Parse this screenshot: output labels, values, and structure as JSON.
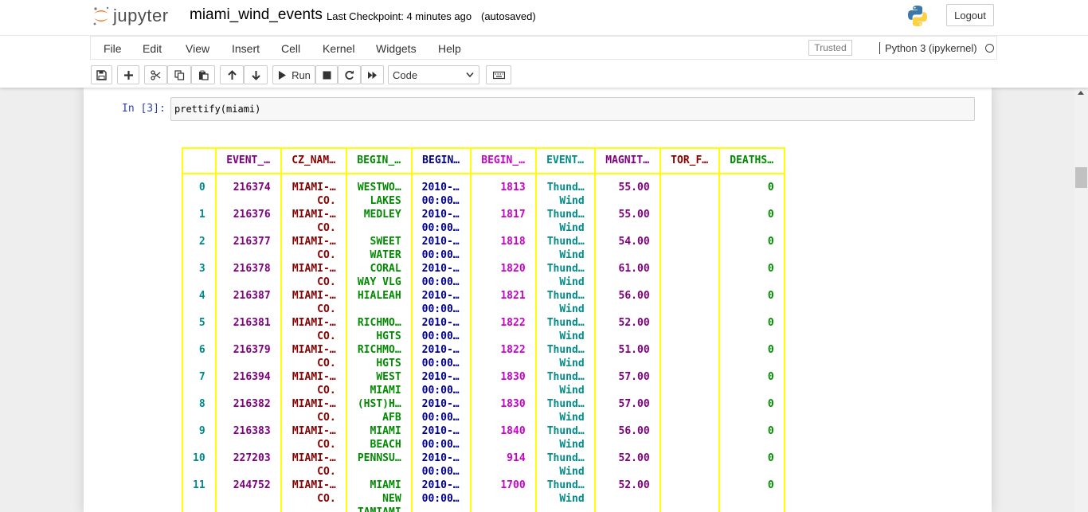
{
  "header": {
    "logo_text": "jupyter",
    "notebook_name": "miami_wind_events",
    "checkpoint": "Last Checkpoint: 4 minutes ago",
    "autosave": "(autosaved)",
    "logout_label": "Logout"
  },
  "menu": {
    "items": [
      "File",
      "Edit",
      "View",
      "Insert",
      "Cell",
      "Kernel",
      "Widgets",
      "Help"
    ],
    "trusted": "Trusted",
    "kernel": "Python 3 (ipykernel)"
  },
  "toolbar": {
    "run_label": "Run",
    "cell_type": "Code"
  },
  "cell": {
    "prompt": "In [3]:",
    "code": "prettify(miami)"
  },
  "table": {
    "headers": [
      "",
      "EVENT_…",
      "CZ_NAM…",
      "BEGIN_…",
      "BEGIN…",
      "BEGIN_…",
      "EVENT…",
      "MAGNIT…",
      "TOR_F…",
      "DEATHS…"
    ],
    "rows": [
      [
        [
          "0"
        ],
        [
          "216374"
        ],
        [
          "MIAMI-…",
          "CO."
        ],
        [
          "WESTWO…",
          "LAKES"
        ],
        [
          "2010-…",
          "00:00…"
        ],
        [
          "1813"
        ],
        [
          "Thund…",
          "Wind"
        ],
        [
          "55.00"
        ],
        [
          ""
        ],
        [
          "0"
        ]
      ],
      [
        [
          "1"
        ],
        [
          "216376"
        ],
        [
          "MIAMI-…",
          "CO."
        ],
        [
          "MEDLEY"
        ],
        [
          "2010-…",
          "00:00…"
        ],
        [
          "1817"
        ],
        [
          "Thund…",
          "Wind"
        ],
        [
          "55.00"
        ],
        [
          ""
        ],
        [
          "0"
        ]
      ],
      [
        [
          "2"
        ],
        [
          "216377"
        ],
        [
          "MIAMI-…",
          "CO."
        ],
        [
          "SWEET",
          "WATER"
        ],
        [
          "2010-…",
          "00:00…"
        ],
        [
          "1818"
        ],
        [
          "Thund…",
          "Wind"
        ],
        [
          "54.00"
        ],
        [
          ""
        ],
        [
          "0"
        ]
      ],
      [
        [
          "3"
        ],
        [
          "216378"
        ],
        [
          "MIAMI-…",
          "CO."
        ],
        [
          "CORAL",
          "WAY VLG"
        ],
        [
          "2010-…",
          "00:00…"
        ],
        [
          "1820"
        ],
        [
          "Thund…",
          "Wind"
        ],
        [
          "61.00"
        ],
        [
          ""
        ],
        [
          "0"
        ]
      ],
      [
        [
          "4"
        ],
        [
          "216387"
        ],
        [
          "MIAMI-…",
          "CO."
        ],
        [
          "HIALEAH"
        ],
        [
          "2010-…",
          "00:00…"
        ],
        [
          "1821"
        ],
        [
          "Thund…",
          "Wind"
        ],
        [
          "56.00"
        ],
        [
          ""
        ],
        [
          "0"
        ]
      ],
      [
        [
          "5"
        ],
        [
          "216381"
        ],
        [
          "MIAMI-…",
          "CO."
        ],
        [
          "RICHMO…",
          "HGTS"
        ],
        [
          "2010-…",
          "00:00…"
        ],
        [
          "1822"
        ],
        [
          "Thund…",
          "Wind"
        ],
        [
          "52.00"
        ],
        [
          ""
        ],
        [
          "0"
        ]
      ],
      [
        [
          "6"
        ],
        [
          "216379"
        ],
        [
          "MIAMI-…",
          "CO."
        ],
        [
          "RICHMO…",
          "HGTS"
        ],
        [
          "2010-…",
          "00:00…"
        ],
        [
          "1822"
        ],
        [
          "Thund…",
          "Wind"
        ],
        [
          "51.00"
        ],
        [
          ""
        ],
        [
          "0"
        ]
      ],
      [
        [
          "7"
        ],
        [
          "216394"
        ],
        [
          "MIAMI-…",
          "CO."
        ],
        [
          "WEST",
          "MIAMI"
        ],
        [
          "2010-…",
          "00:00…"
        ],
        [
          "1830"
        ],
        [
          "Thund…",
          "Wind"
        ],
        [
          "57.00"
        ],
        [
          ""
        ],
        [
          "0"
        ]
      ],
      [
        [
          "8"
        ],
        [
          "216382"
        ],
        [
          "MIAMI-…",
          "CO."
        ],
        [
          "(HST)H…",
          "AFB"
        ],
        [
          "2010-…",
          "00:00…"
        ],
        [
          "1830"
        ],
        [
          "Thund…",
          "Wind"
        ],
        [
          "57.00"
        ],
        [
          ""
        ],
        [
          "0"
        ]
      ],
      [
        [
          "9"
        ],
        [
          "216383"
        ],
        [
          "MIAMI-…",
          "CO."
        ],
        [
          "MIAMI",
          "BEACH"
        ],
        [
          "2010-…",
          "00:00…"
        ],
        [
          "1840"
        ],
        [
          "Thund…",
          "Wind"
        ],
        [
          "56.00"
        ],
        [
          ""
        ],
        [
          "0"
        ]
      ],
      [
        [
          "10"
        ],
        [
          "227203"
        ],
        [
          "MIAMI-…",
          "CO."
        ],
        [
          "PENNSU…"
        ],
        [
          "2010-…",
          "00:00…"
        ],
        [
          "914"
        ],
        [
          "Thund…",
          "Wind"
        ],
        [
          "52.00"
        ],
        [
          ""
        ],
        [
          "0"
        ]
      ],
      [
        [
          "11"
        ],
        [
          "244752"
        ],
        [
          "MIAMI-…",
          "CO."
        ],
        [
          "MIAMI",
          "NEW",
          "TAMIAMI"
        ],
        [
          "2010-…",
          "00:00…"
        ],
        [
          "1700"
        ],
        [
          "Thund…",
          "Wind"
        ],
        [
          "52.00"
        ],
        [
          ""
        ],
        [
          "0"
        ]
      ]
    ]
  },
  "colors": {
    "border_yellow": "#ffff00",
    "prompt_blue": "#303f9f",
    "logo_orange": "#f37726"
  }
}
